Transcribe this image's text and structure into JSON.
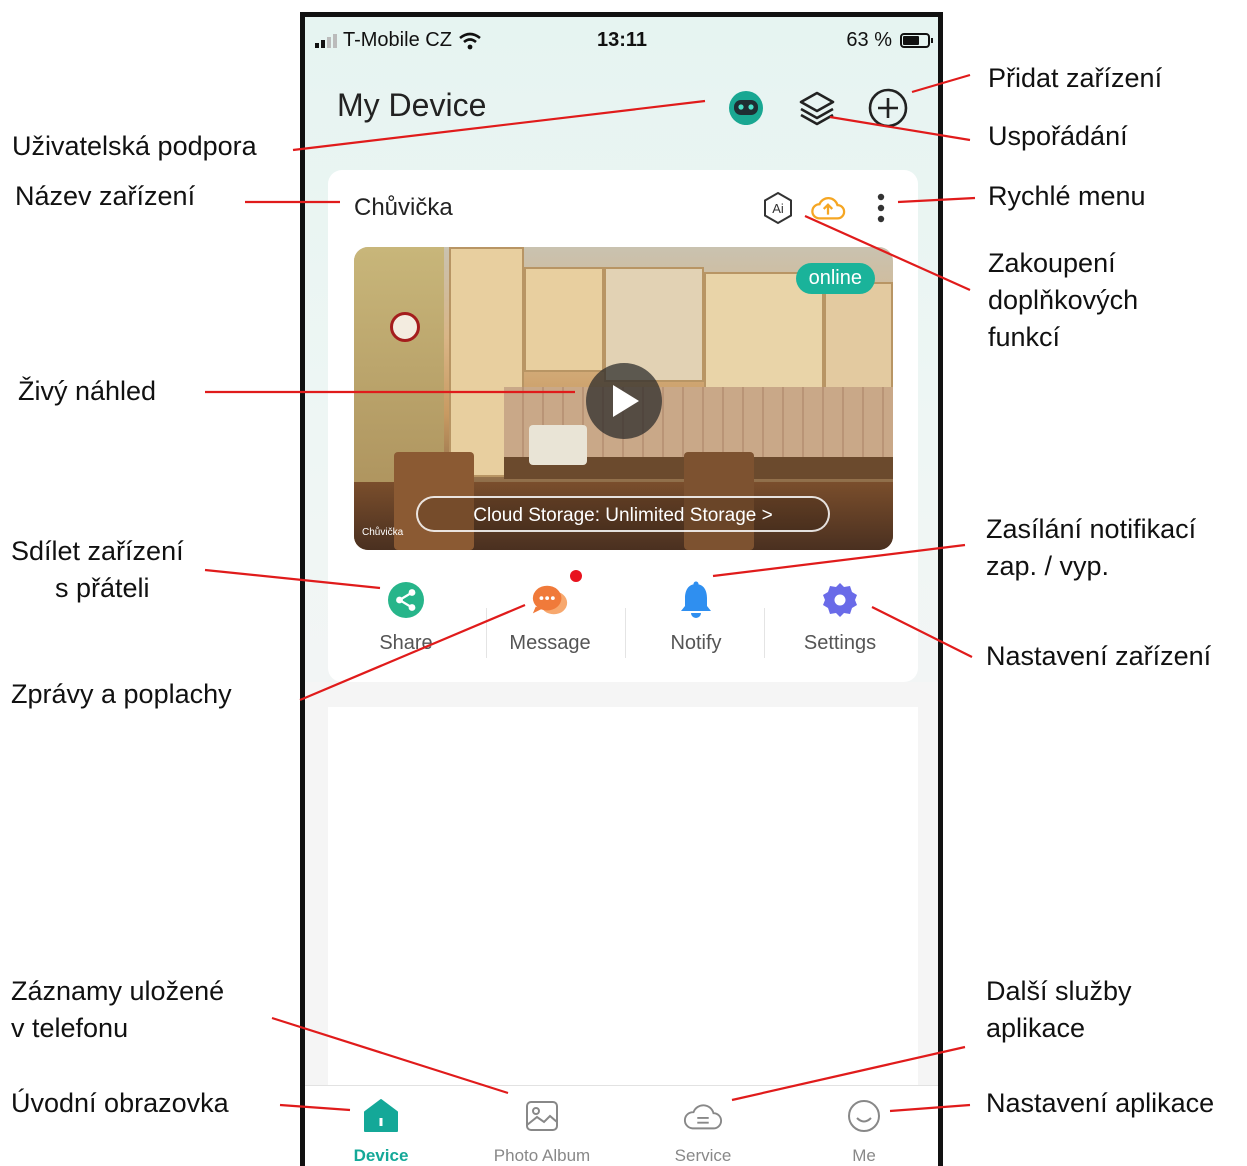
{
  "status_bar": {
    "carrier": "T-Mobile CZ",
    "time": "13:11",
    "battery": "63 %"
  },
  "header": {
    "title": "My Device",
    "icons": [
      "support-bot-icon",
      "layers-icon",
      "add-circle-icon"
    ]
  },
  "device_card": {
    "name": "Chůvička",
    "status": "online",
    "cloud_banner": "Cloud Storage: Unlimited Storage >",
    "watermark": "Chůvička",
    "actions": [
      {
        "label": "Share",
        "icon": "share-icon",
        "color": "#27b58a"
      },
      {
        "label": "Message",
        "icon": "message-icon",
        "color": "#f07a3a"
      },
      {
        "label": "Notify",
        "icon": "bell-icon",
        "color": "#2f8ff0"
      },
      {
        "label": "Settings",
        "icon": "gear-icon",
        "color": "#6a6be8"
      }
    ]
  },
  "tabbar": {
    "tabs": [
      {
        "label": "Device",
        "icon": "home-icon",
        "active": true
      },
      {
        "label": "Photo Album",
        "icon": "photo-icon",
        "active": false
      },
      {
        "label": "Service",
        "icon": "service-icon",
        "active": false
      },
      {
        "label": "Me",
        "icon": "smile-icon",
        "active": false
      }
    ]
  },
  "annotations": {
    "support": "Uživatelská podpora",
    "device_name": "Název zařízení",
    "live_preview": "Živý náhled",
    "share_line1": "Sdílet zařízení",
    "share_line2": "s přáteli",
    "messages": "Zprávy a poplachy",
    "records_line1": "Záznamy uložené",
    "records_line2": "v telefonu",
    "home_screen": "Úvodní obrazovka",
    "add_device": "Přidat zařízení",
    "arrange": "Uspořádání",
    "quick_menu": "Rychlé menu",
    "purchase_line1": "Zakoupení",
    "purchase_line2": "doplňkových",
    "purchase_line3": "funkcí",
    "notify_line1": "Zasílání notifikací",
    "notify_line2": "zap. / vyp.",
    "device_settings": "Nastavení zařízení",
    "services_line1": "Další služby",
    "services_line2": "aplikace",
    "app_settings": "Nastavení aplikace"
  },
  "colors": {
    "accent": "#14a898",
    "annotation_line": "#e01b1b",
    "online": "#1ab39a",
    "cloud_upload": "#f5a623"
  }
}
